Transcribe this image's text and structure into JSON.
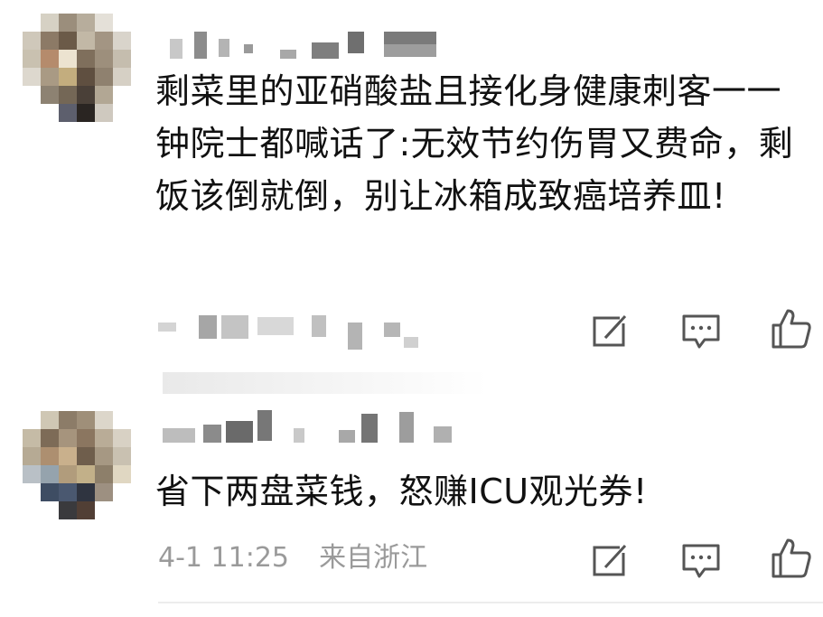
{
  "comments": [
    {
      "text": "剩菜里的亚硝酸盐且接化身健康刺客一一钟院士都喊话了:无效节约伤胃又费命，剩饭该倒就倒，别让冰箱成致癌培养皿!",
      "avatar": "pixelated-avatar",
      "username_obscured": true,
      "meta_obscured": true
    },
    {
      "text": "省下两盘菜钱，怒赚ICU观光券!",
      "avatar": "pixelated-avatar",
      "username_obscured": true,
      "meta_time": "4-1 11:25",
      "meta_location": "来自浙江"
    }
  ],
  "actions": {
    "forward": "edit-forward-icon",
    "reply": "comment-bubble-icon",
    "like": "thumbs-up-icon"
  },
  "colors": {
    "text": "#111111",
    "meta": "#9a9a9a",
    "icon": "#555555",
    "divider": "#ececec"
  }
}
